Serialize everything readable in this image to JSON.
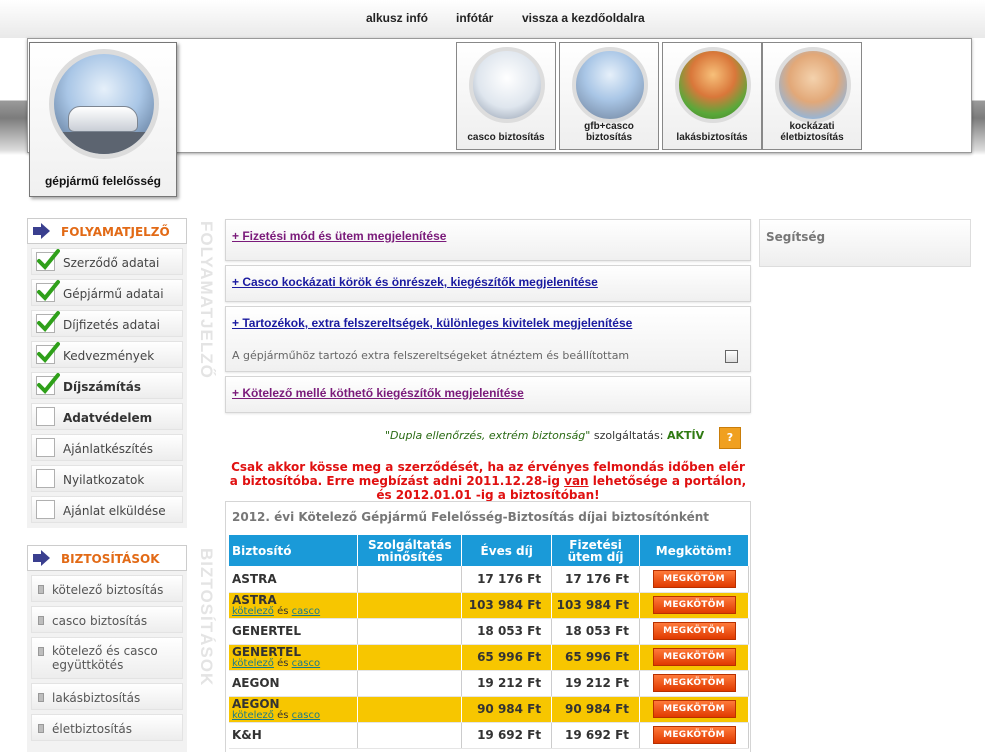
{
  "top_nav": [
    "alkusz infó",
    "infótár",
    "vissza a kezdőoldalra"
  ],
  "logo": {
    "label": "gépjármű felelősség"
  },
  "tiles": [
    {
      "label": "casco biztosítás"
    },
    {
      "label": "gfb+casco biztosítás"
    },
    {
      "label": "lakásbiztosítás"
    },
    {
      "label": "kockázati életbiztosítás"
    }
  ],
  "progress": {
    "title": "FOLYAMATJELZŐ",
    "vertical": "FOLYAMATJELZŐ",
    "items": [
      {
        "label": "Szerződő adatai",
        "checked": true,
        "bold": false
      },
      {
        "label": "Gépjármű adatai",
        "checked": true,
        "bold": false
      },
      {
        "label": "Díjfizetés adatai",
        "checked": true,
        "bold": false
      },
      {
        "label": "Kedvezmények",
        "checked": true,
        "bold": false
      },
      {
        "label": "Díjszámítás",
        "checked": true,
        "bold": true
      },
      {
        "label": "Adatvédelem",
        "checked": false,
        "bold": true
      },
      {
        "label": "Ajánlatkészítés",
        "checked": false,
        "bold": false
      },
      {
        "label": "Nyilatkozatok",
        "checked": false,
        "bold": false
      },
      {
        "label": "Ajánlat elküldése",
        "checked": false,
        "bold": false
      }
    ]
  },
  "insurances": {
    "title": "BIZTOSÍTÁSOK",
    "vertical": "BIZTOSÍTÁSOK",
    "items": [
      "kötelező biztosítás",
      "casco biztosítás",
      "kötelező és casco együttkötés",
      "lakásbiztosítás",
      "életbiztosítás"
    ]
  },
  "panels": {
    "p1": "+ Fizetési mód és ütem megjelenítése",
    "p2": "+ Casco kockázati körök és önrészek, kiegészítők megjelenítése",
    "p3": "+ Tartozékok, extra felszereltségek, különleges kivitelek megjelenítése",
    "p3_text": "A gépjárműhöz tartozó extra felszereltségeket átnéztem és beállítottam",
    "p4": "+ Kötelező mellé köthető kiegészítők megjelenítése"
  },
  "help": {
    "title": "Segítség"
  },
  "dupla": {
    "quote": "\"Dupla ellenőrzés, extrém biztonság\"",
    "middle": " szolgáltatás: ",
    "status": "AKTÍV",
    "q": "?"
  },
  "warning": {
    "part1": "Csak akkor kösse meg a szerződését, ha az érvényes felmondás időben elér a biztosítóba. Erre megbízást adni 2011.12.28-ig ",
    "van": "van",
    "part2": " lehetősége a portálon, és 2012.01.01 -ig a biztosítóban!"
  },
  "table": {
    "title": "2012. évi Kötelező Gépjármű Felelősség-Biztosítás díjai biztosítónként",
    "headers": [
      "Biztosító",
      "Szolgáltatás minősítés",
      "Éves díj",
      "Fizetési ütem díj",
      "Megkötöm!"
    ],
    "link1": "kötelező",
    "and": " és ",
    "link2": "casco",
    "button": "MEGKÖTÖM",
    "rows": [
      {
        "name": "ASTRA",
        "annual": "17 176 Ft",
        "installment": "17 176 Ft",
        "combo": false
      },
      {
        "name": "ASTRA",
        "annual": "103 984 Ft",
        "installment": "103 984 Ft",
        "combo": true
      },
      {
        "name": "GENERTEL",
        "annual": "18 053 Ft",
        "installment": "18 053 Ft",
        "combo": false
      },
      {
        "name": "GENERTEL",
        "annual": "65 996 Ft",
        "installment": "65 996 Ft",
        "combo": true
      },
      {
        "name": "AEGON",
        "annual": "19 212 Ft",
        "installment": "19 212 Ft",
        "combo": false
      },
      {
        "name": "AEGON",
        "annual": "90 984 Ft",
        "installment": "90 984 Ft",
        "combo": true
      },
      {
        "name": "K&H",
        "annual": "19 692 Ft",
        "installment": "19 692 Ft",
        "combo": false
      }
    ]
  },
  "colors": {
    "accent": "#e26a16",
    "table_header": "#1a9ad8",
    "combo_row": "#f7c600",
    "warning": "#e01010"
  }
}
